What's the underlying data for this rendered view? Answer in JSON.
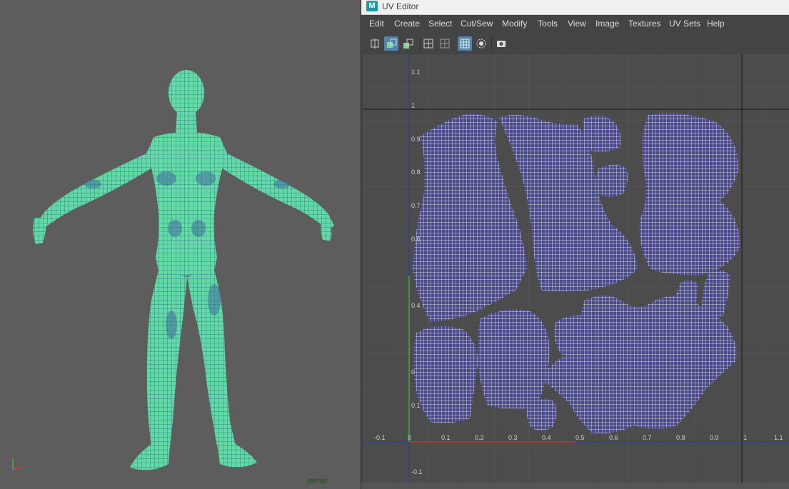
{
  "viewport": {
    "camera_label": "persp",
    "axis_icon": "xyz-axis-icon",
    "wire_color": "#63e0a6",
    "background": "#5d5d5d"
  },
  "uv_editor": {
    "title": "UV Editor",
    "app_icon": "M",
    "menu": [
      "Edit",
      "Create",
      "Select",
      "Cut/Sew",
      "Modify",
      "Tools",
      "View",
      "Image",
      "Textures",
      "UV Sets",
      "Help"
    ],
    "toolbar_icons": [
      "uv-shell-icon",
      "uv-select-active-icon",
      "uv-tiles-icon",
      "grid-icon",
      "grid-subdiv-icon",
      "grid-active-icon",
      "radial-icon",
      "snapshot-icon"
    ],
    "axis_ticks_u": [
      "-0.1",
      "0",
      "0.1",
      "0.2",
      "0.3",
      "0.4",
      "0.5",
      "0.6",
      "0.7",
      "0.8",
      "0.9",
      "1",
      "1.1"
    ],
    "axis_ticks_v": [
      "1.1",
      "1",
      "0.9",
      "0.8",
      "0.7",
      "0.6",
      "0.4",
      "0",
      "0.1",
      "-0.1"
    ],
    "accent": "#5285a6",
    "u_axis_color": "#c0392b",
    "v_axis_color": "#3fae3f"
  }
}
